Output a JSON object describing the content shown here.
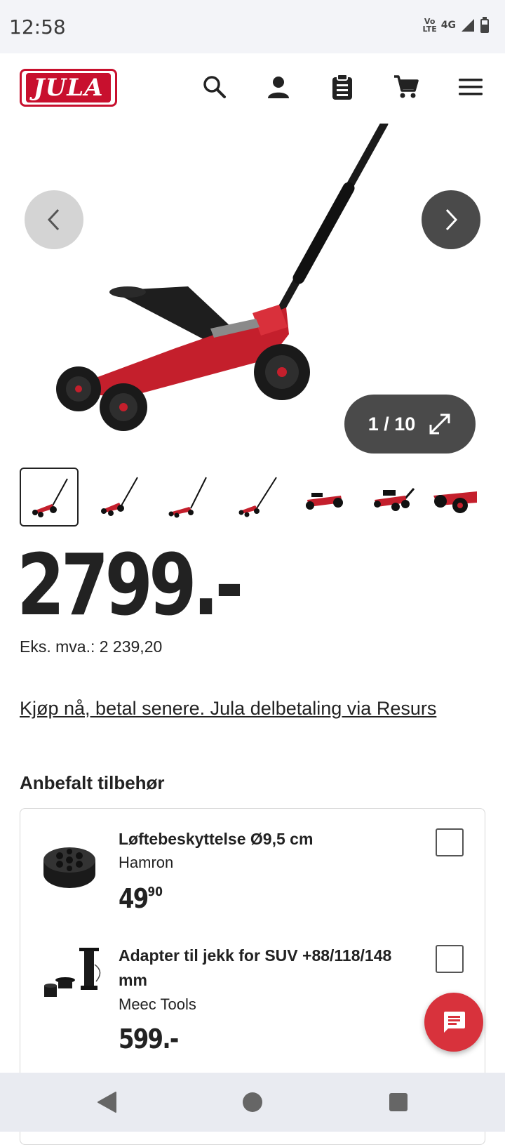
{
  "status_bar": {
    "time": "12:58",
    "volte_top": "Vo",
    "volte_bottom": "LTE",
    "network": "4G"
  },
  "header": {
    "logo_text": "JULA"
  },
  "gallery": {
    "counter": "1 / 10"
  },
  "product": {
    "price": "2799.-",
    "ex_vat": "Eks. mva.: 2 239,20",
    "pay_later_link": "Kjøp nå, betal senere. Jula delbetaling via Resurs"
  },
  "accessories": {
    "title": "Anbefalt tilbehør",
    "items": [
      {
        "name": "Løftebeskyttelse Ø9,5 cm",
        "brand": "Hamron",
        "price_main": "49",
        "price_cents": "90",
        "checked": false
      },
      {
        "name": "Adapter til jekk for SUV +88/118/148 mm",
        "brand": "Meec Tools",
        "price_main": "599.-",
        "price_cents": "",
        "checked": false
      }
    ]
  },
  "colors": {
    "brand_red": "#c8102e",
    "chat_red": "#d8323c",
    "dark_button": "#4a4a4a"
  }
}
